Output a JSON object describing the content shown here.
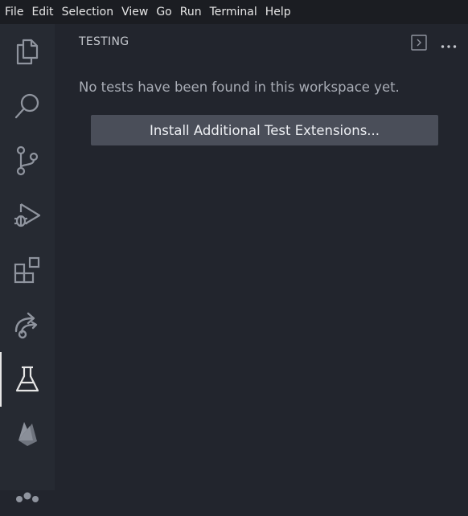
{
  "menubar": {
    "items": [
      "File",
      "Edit",
      "Selection",
      "View",
      "Go",
      "Run",
      "Terminal",
      "Help"
    ]
  },
  "activity_bar": {
    "items": [
      {
        "icon": "files-icon",
        "active": false
      },
      {
        "icon": "search-icon",
        "active": false
      },
      {
        "icon": "source-control-icon",
        "active": false
      },
      {
        "icon": "run-debug-icon",
        "active": false
      },
      {
        "icon": "extensions-icon",
        "active": false
      },
      {
        "icon": "remote-share-icon",
        "active": false
      },
      {
        "icon": "testing-flask-icon",
        "active": true
      },
      {
        "icon": "firebase-icon",
        "active": false
      },
      {
        "icon": "community-icon",
        "active": false
      }
    ]
  },
  "sidebar": {
    "title": "TESTING",
    "message": "No tests have been found in this workspace yet.",
    "install_button_label": "Install Additional Test Extensions...",
    "actions": [
      "show-output-icon",
      "more-actions-icon"
    ]
  },
  "colors": {
    "menubar_bg": "#1b1d22",
    "activity_bg": "#262a32",
    "sidebar_bg": "#22252d",
    "button_bg": "#4a4e59",
    "icon": "#8f949e",
    "icon_active": "#e6e6e6"
  }
}
